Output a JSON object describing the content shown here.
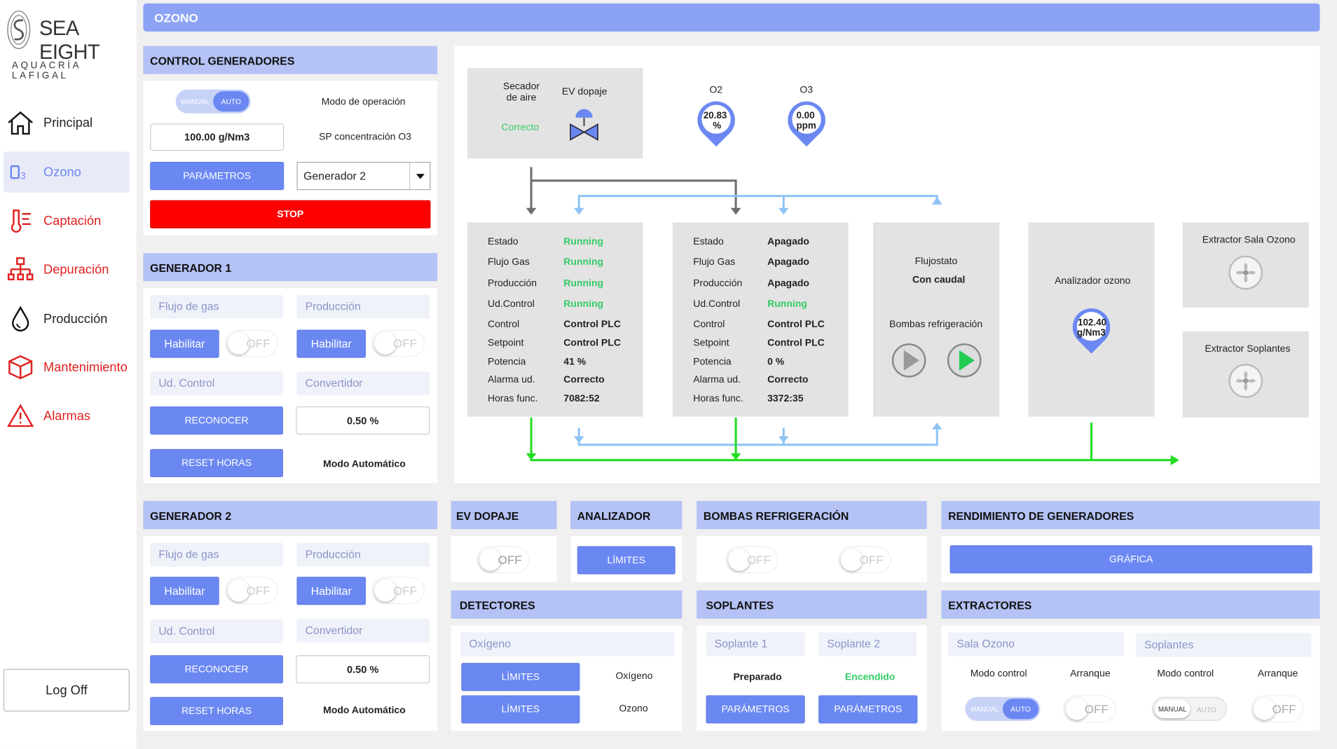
{
  "app": {
    "brand": "SEA EIGHT",
    "brand_sub": "AQUACRÍA LAFIGAL",
    "page_title": "OZONO"
  },
  "nav": {
    "items": [
      {
        "label": "Principal",
        "icon": "home-icon"
      },
      {
        "label": "Ozono",
        "icon": "ozone-icon"
      },
      {
        "label": "Captación",
        "icon": "thermometer-icon"
      },
      {
        "label": "Depuración",
        "icon": "network-icon"
      },
      {
        "label": "Producción",
        "icon": "drop-icon"
      },
      {
        "label": "Mantenimiento",
        "icon": "cube-icon"
      },
      {
        "label": "Alarmas",
        "icon": "warning-icon"
      }
    ],
    "logoff": "Log Off"
  },
  "control": {
    "title": "CONTROL GENERADORES",
    "mode_manual": "MANUAL",
    "mode_auto": "AUTO",
    "mode_label": "Modo de operación",
    "sp_value": "100.00 g/Nm3",
    "sp_label": "SP concentración O3",
    "params_btn": "PARÁMETROS",
    "generator_select": "Generador 2",
    "stop_btn": "STOP"
  },
  "gen1": {
    "title": "GENERADOR 1",
    "flujo": "Flujo de gas",
    "produccion": "Producción",
    "habilitar": "Habilitar",
    "off": "OFF",
    "ud_control": "Ud. Control",
    "convertidor": "Convertidor",
    "reconocer": "RECONOCER",
    "conv_value": "0.50 %",
    "reset": "RESET HORAS",
    "modo": "Modo Automático"
  },
  "gen2": {
    "title": "GENERADOR 2",
    "flujo": "Flujo de gas",
    "produccion": "Producción",
    "habilitar": "Habilitar",
    "off": "OFF",
    "ud_control": "Ud. Control",
    "convertidor": "Convertidor",
    "reconocer": "RECONOCER",
    "conv_value": "0.50 %",
    "reset": "RESET HORAS",
    "modo": "Modo Automático"
  },
  "diagram": {
    "secador": "Secador\nde aire",
    "secador_status": "Correcto",
    "ev_dopaje": "EV dopaje",
    "o2_label": "O2",
    "o2_value": "20.83",
    "o2_unit": "%",
    "o3_label": "O3",
    "o3_value": "0.00",
    "o3_unit": "ppm",
    "g1": {
      "rows": [
        [
          "Estado",
          "Running"
        ],
        [
          "Flujo Gas",
          "Running"
        ],
        [
          "Producción",
          "Running"
        ],
        [
          "Ud.Control",
          "Running"
        ],
        [
          "Control",
          "Control PLC"
        ],
        [
          "Setpoint",
          "Control PLC"
        ],
        [
          "Potencia",
          "41 %"
        ],
        [
          "Alarma ud.",
          "Correcto"
        ],
        [
          "Horas func.",
          "7082:52"
        ]
      ]
    },
    "g2": {
      "rows": [
        [
          "Estado",
          "Apagado"
        ],
        [
          "Flujo Gas",
          "Apagado"
        ],
        [
          "Producción",
          "Apagado"
        ],
        [
          "Ud.Control",
          "Running"
        ],
        [
          "Control",
          "Control PLC"
        ],
        [
          "Setpoint",
          "Control PLC"
        ],
        [
          "Potencia",
          "0 %"
        ],
        [
          "Alarma ud.",
          "Correcto"
        ],
        [
          "Horas func.",
          "3372:35"
        ]
      ]
    },
    "flujostato": "Flujostato",
    "flujostato_status": "Con caudal",
    "bombas": "Bombas refrigeración",
    "analizador": "Analizador ozono",
    "analizador_value": "102.40",
    "analizador_unit": "g/Nm3",
    "extractor1": "Extractor Sala Ozono",
    "extractor2": "Extractor Soplantes",
    "colors": {
      "green": "#33cc66",
      "gray_line": "#6e6e6e",
      "blue_line": "#8fc3f5",
      "green_line": "#22dd22",
      "gauge": "#6b88f2"
    }
  },
  "ev": {
    "title": "EV DOPAJE",
    "off": "OFF"
  },
  "analizador": {
    "title": "ANALIZADOR",
    "limites": "LÍMITES"
  },
  "bombas": {
    "title": "BOMBAS REFRIGERACIÓN",
    "off1": "OFF",
    "off2": "OFF"
  },
  "rendimiento": {
    "title": "RENDIMIENTO DE GENERADORES",
    "grafica": "GRÁFICA"
  },
  "detectores": {
    "title": "DETECTORES",
    "field": "Oxígeno",
    "limites1": "LÍMITES",
    "label1": "Oxígeno",
    "limites2": "LÍMITES",
    "label2": "Ozono"
  },
  "soplantes": {
    "title": "SOPLANTES",
    "s1": "Soplante 1",
    "s2": "Soplante 2",
    "s1_status": "Preparado",
    "s2_status": "Encendido",
    "params1": "PARÁMETROS",
    "params2": "PARÁMETROS"
  },
  "extractores": {
    "title": "EXTRACTORES",
    "sala": "Sala Ozono",
    "soplantes": "Soplantes",
    "modo1": "Modo control",
    "arr1": "Arranque",
    "modo2": "Modo control",
    "arr2": "Arranque",
    "manual": "MANUAL",
    "auto": "AUTO",
    "off": "OFF"
  }
}
